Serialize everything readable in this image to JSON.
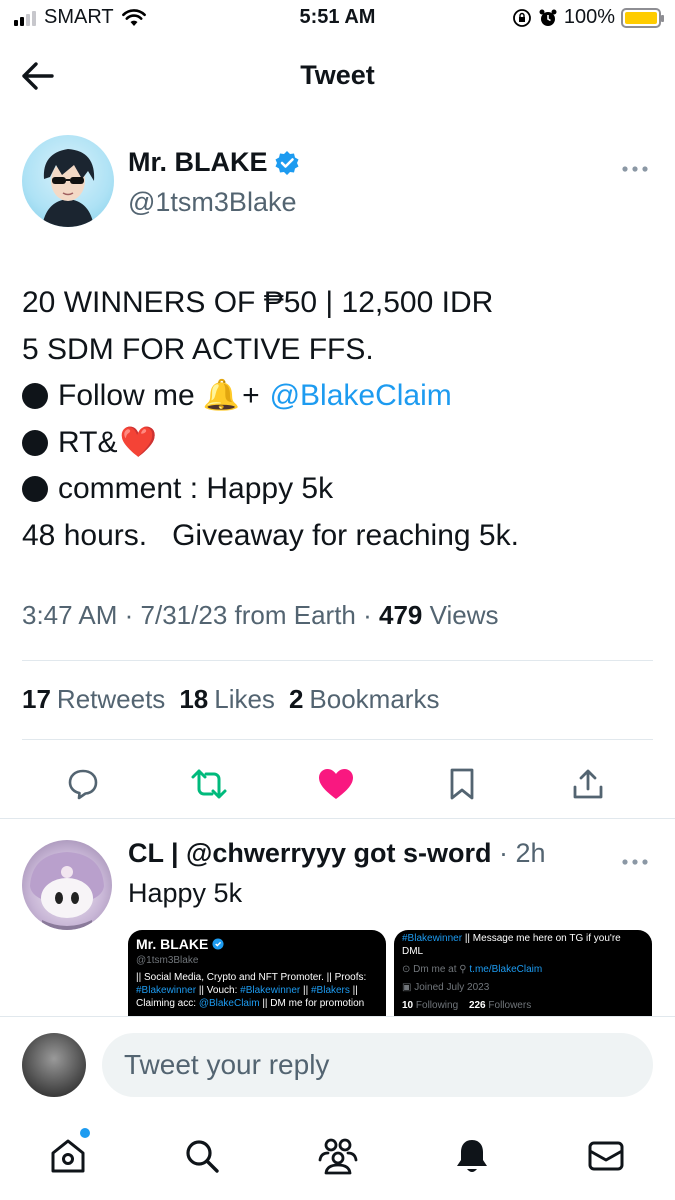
{
  "status_bar": {
    "carrier": "SMART",
    "time": "5:51 AM",
    "battery": "100%",
    "battery_level": 1.0
  },
  "header": {
    "title": "Tweet"
  },
  "tweet": {
    "author_name": "Mr. BLAKE",
    "author_handle": "@1tsm3Blake",
    "lines": {
      "l1": "20 WINNERS OF ₱50 | 12,500 IDR",
      "l2": "5 SDM FOR ACTIVE FFS.",
      "l3_text": "Follow me",
      "l3_emoji": "🔔",
      "l3_plus": "+",
      "l3_link": "@BlakeClaim",
      "l4_text": "RT&",
      "l4_emoji": "❤️",
      "l5": "comment : Happy 5k",
      "l6": "48 hours.   Giveaway for reaching 5k."
    },
    "time": "3:47 AM",
    "date": "7/31/23",
    "source": "from Earth",
    "views_count": "479",
    "views_label": "Views",
    "retweets_count": "17",
    "retweets_label": "Retweets",
    "likes_count": "18",
    "likes_label": "Likes",
    "bookmarks_count": "2",
    "bookmarks_label": "Bookmarks"
  },
  "reply": {
    "author": "CL | @chwerryyy got s-word",
    "time": "2h",
    "text": "Happy 5k",
    "media1": {
      "name": "Mr. BLAKE",
      "handle": "@1tsm3Blake",
      "bio_1": "|| Social Media, Crypto and NFT Promoter. || Proofs:",
      "bio_2a": "#Blakewinner",
      "bio_2b": " || Vouch: ",
      "bio_2c": "#Blakewinner",
      "bio_2d": " || ",
      "bio_2e": "#Blakers",
      "bio_2f": " ||",
      "bio_3a": "Claiming acc: ",
      "bio_3b": "@BlakeClaim",
      "bio_3c": " || DM me for promotion"
    },
    "media2": {
      "line1a": "#Blakewinner",
      "line1b": " || Message me here on TG if you're DML",
      "location": "Dm me at",
      "link": "t.me/BlakeClaim",
      "joined": "Joined July 2023",
      "following_count": "10",
      "following_label": "Following",
      "followers_count": "226",
      "followers_label": "Followers"
    }
  },
  "compose": {
    "placeholder": "Tweet your reply"
  },
  "icons": {
    "back": "arrow-left-icon",
    "verified": "verified-badge-icon",
    "reply": "speech-bubble-icon",
    "retweet": "retweet-icon",
    "like": "heart-icon",
    "bookmark": "bookmark-icon",
    "share": "share-icon",
    "home": "home-icon",
    "search": "search-icon",
    "communities": "communities-icon",
    "notifications": "bell-icon",
    "messages": "mail-icon"
  },
  "colors": {
    "accent": "#1d9bf0",
    "retweet_active": "#00ba7c",
    "like_active": "#f91880",
    "muted": "#536471"
  }
}
